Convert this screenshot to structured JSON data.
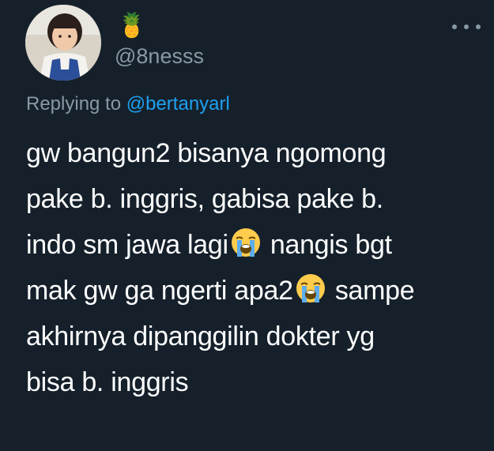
{
  "tweet": {
    "display_name": "🍍",
    "handle": "@8nesss",
    "reply": {
      "prefix": "Replying to ",
      "mention": "@bertanyarl"
    },
    "lines": [
      {
        "before": "gw bangun2 bisanya ngomong",
        "emoji": "",
        "after": ""
      },
      {
        "before": "pake b. inggris, gabisa pake b.",
        "emoji": "",
        "after": ""
      },
      {
        "before": "indo sm jawa lagi",
        "emoji": "loudly-crying-face",
        "after": " nangis bgt"
      },
      {
        "before": "mak gw ga ngerti apa2",
        "emoji": "loudly-crying-face",
        "after": " sampe"
      },
      {
        "before": "akhirnya dipanggilin dokter yg",
        "emoji": "",
        "after": ""
      },
      {
        "before": "bisa b. inggris",
        "emoji": "",
        "after": ""
      }
    ]
  },
  "colors": {
    "background": "#15202b",
    "text": "#ffffff",
    "secondary": "#8899a6",
    "link": "#1da1f2"
  }
}
